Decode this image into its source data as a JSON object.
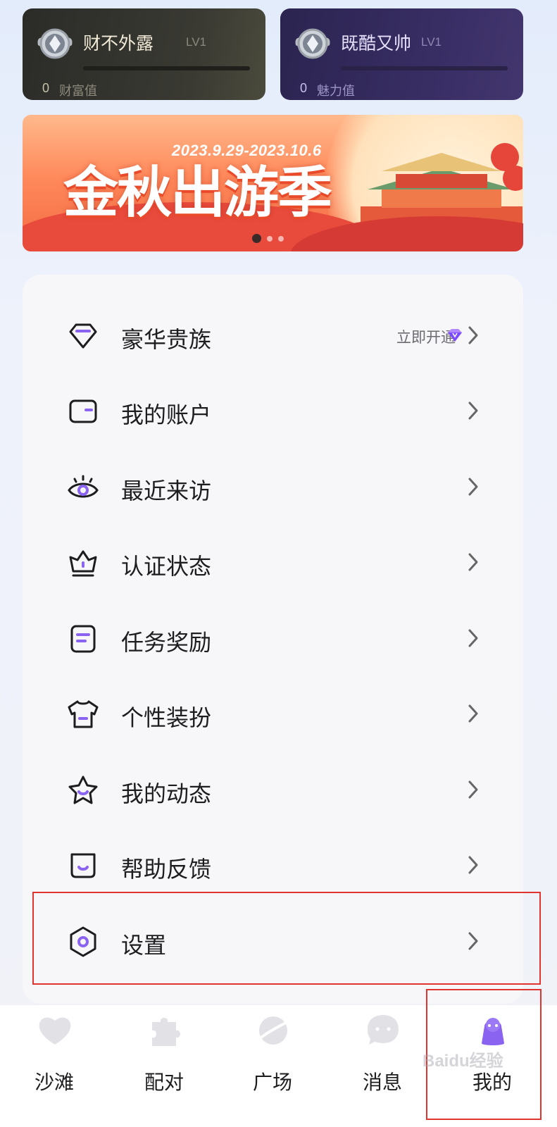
{
  "cards": [
    {
      "name": "财不外露",
      "level": "LV1",
      "value": "0",
      "value_label": "财富值"
    },
    {
      "name": "既酷又帅",
      "level": "LV1",
      "value": "0",
      "value_label": "魅力值"
    }
  ],
  "banner": {
    "title": "金秋出游季",
    "date_range": "2023.9.29-2023.10.6",
    "page_count": 3,
    "active_page": 0
  },
  "menu": {
    "items": [
      {
        "label": "豪华贵族",
        "icon": "diamond-outline-icon",
        "extra": "立即开通"
      },
      {
        "label": "我的账户",
        "icon": "wallet-icon"
      },
      {
        "label": "最近来访",
        "icon": "eye-icon"
      },
      {
        "label": "认证状态",
        "icon": "crown-icon"
      },
      {
        "label": "任务奖励",
        "icon": "task-list-icon"
      },
      {
        "label": "个性装扮",
        "icon": "shirt-icon"
      },
      {
        "label": "我的动态",
        "icon": "star-icon"
      },
      {
        "label": "帮助反馈",
        "icon": "help-feedback-icon"
      },
      {
        "label": "设置",
        "icon": "hexagon-settings-icon"
      }
    ]
  },
  "tabs": [
    {
      "label": "沙滩",
      "icon": "heart-icon",
      "active": false
    },
    {
      "label": "配对",
      "icon": "puzzle-icon",
      "active": false
    },
    {
      "label": "广场",
      "icon": "planet-icon",
      "active": false
    },
    {
      "label": "消息",
      "icon": "chat-bubble-icon",
      "active": false
    },
    {
      "label": "我的",
      "icon": "profile-icon",
      "active": true
    }
  ],
  "colors": {
    "accent": "#8a63f0",
    "highlight_box": "#e0352f"
  },
  "watermark": "Baidu经验"
}
